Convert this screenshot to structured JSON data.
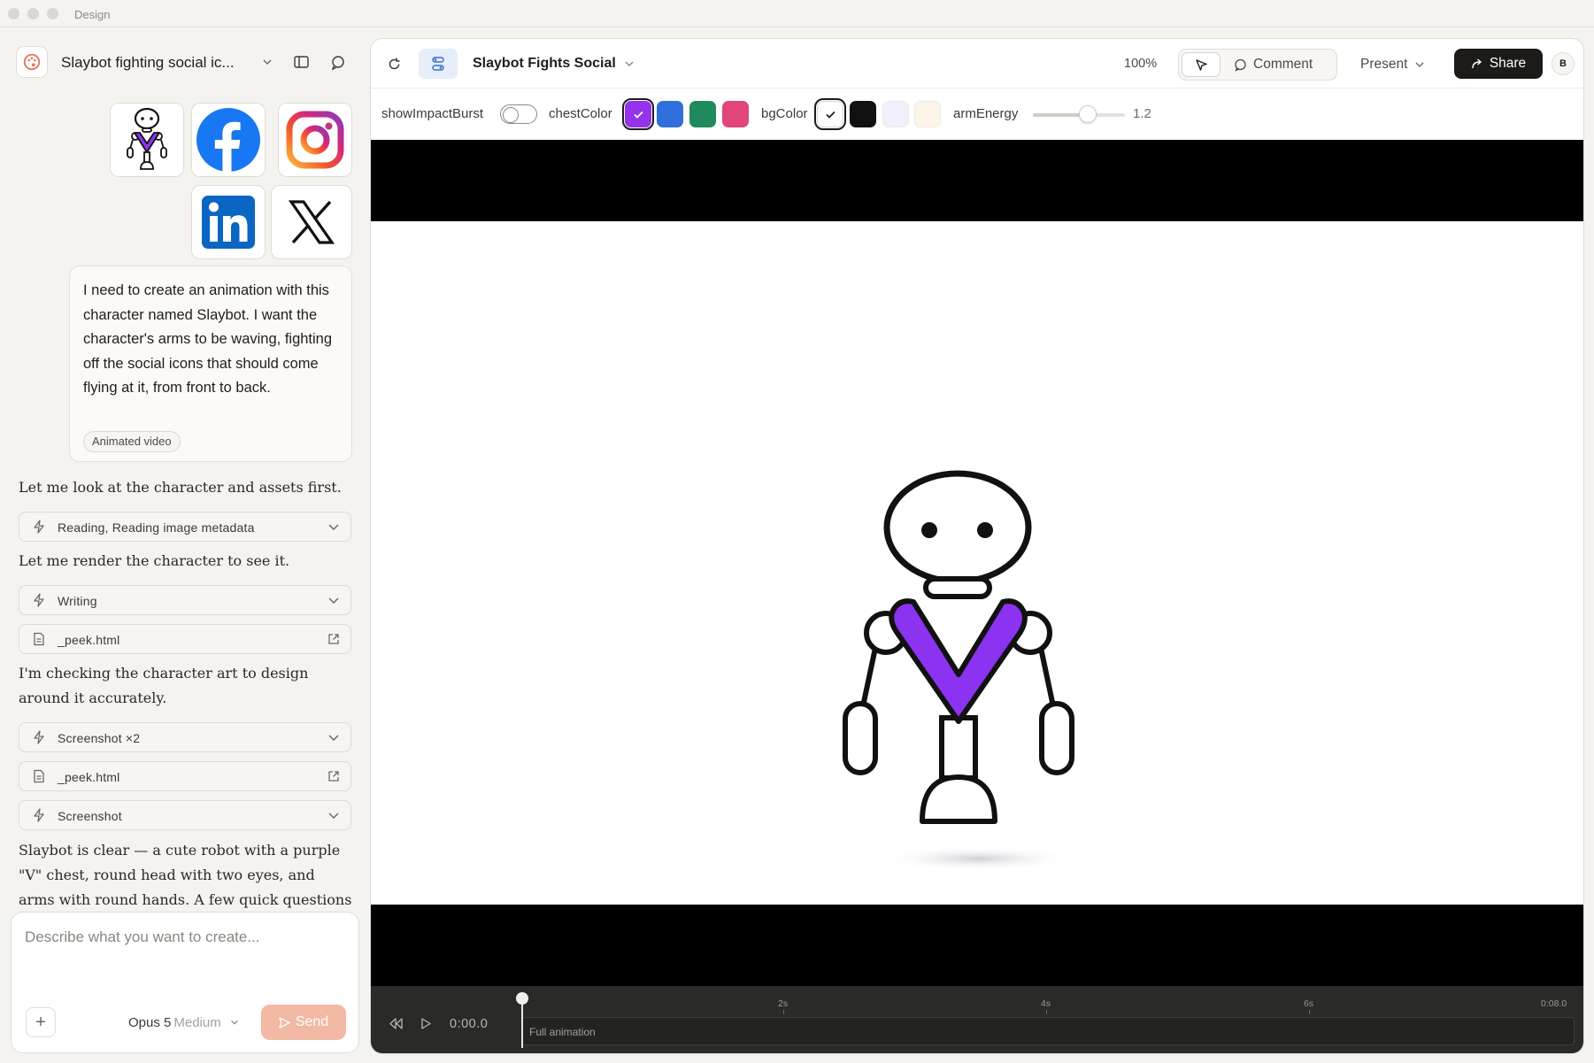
{
  "window": {
    "title": "Design"
  },
  "project": {
    "title": "Slaybot fighting social ic..."
  },
  "attachments": [
    "Slaybot character",
    "facebook",
    "instagram",
    "linkedin",
    "x"
  ],
  "user_message": {
    "text": "I need to create an animation with this character named Slaybot. I want the character's arms to be waving, fighting off the social icons that should come flying at it, from front to back.",
    "tag": "Animated video"
  },
  "conversation": {
    "ai_1": "Let me look at the character and assets first.",
    "tool_1": "Reading, Reading image metadata",
    "ai_2": "Let me render the character to see it.",
    "tool_2": "Writing",
    "file_1": "_peek.html",
    "ai_3": "I'm checking the character art to design around it accurately.",
    "tool_3": "Screenshot ×2",
    "file_2": "_peek.html",
    "tool_4": "Screenshot",
    "ai_4": "Slaybot is clear — a cute robot with a purple \"V\" chest, round head with two eyes, and arms with round hands. A few quick questions"
  },
  "composer": {
    "placeholder": "Describe what you want to create...",
    "model": "Opus 5",
    "effort": "Medium",
    "send_label": "Send"
  },
  "toolbar": {
    "file_title": "Slaybot Fights Social",
    "zoom": "100%",
    "comment_label": "Comment",
    "present_label": "Present",
    "share_label": "Share",
    "avatar_initial": "B"
  },
  "tweaks": {
    "show_impact_label": "showImpactBurst",
    "show_impact_value": false,
    "chest_label": "chestColor",
    "chest_colors": [
      "#9333ea",
      "#2f6fdb",
      "#1f8a5b",
      "#e0457b"
    ],
    "chest_selected": 0,
    "bg_label": "bgColor",
    "bg_colors": [
      "#ffffff",
      "#111111",
      "#f1effb",
      "#fbf6e8"
    ],
    "bg_selected": 0,
    "arm_label": "armEnergy",
    "arm_value": "1.2",
    "arm_fraction": 0.6
  },
  "timeline": {
    "time": "0:00.0",
    "track_label": "Full animation",
    "ticks": [
      "2s",
      "4s",
      "6s",
      "0:08.0"
    ]
  },
  "colors": {
    "accent_purple": "#8b33f0",
    "share_bg": "#1c1b19",
    "send_bg": "#f2b9a4"
  }
}
